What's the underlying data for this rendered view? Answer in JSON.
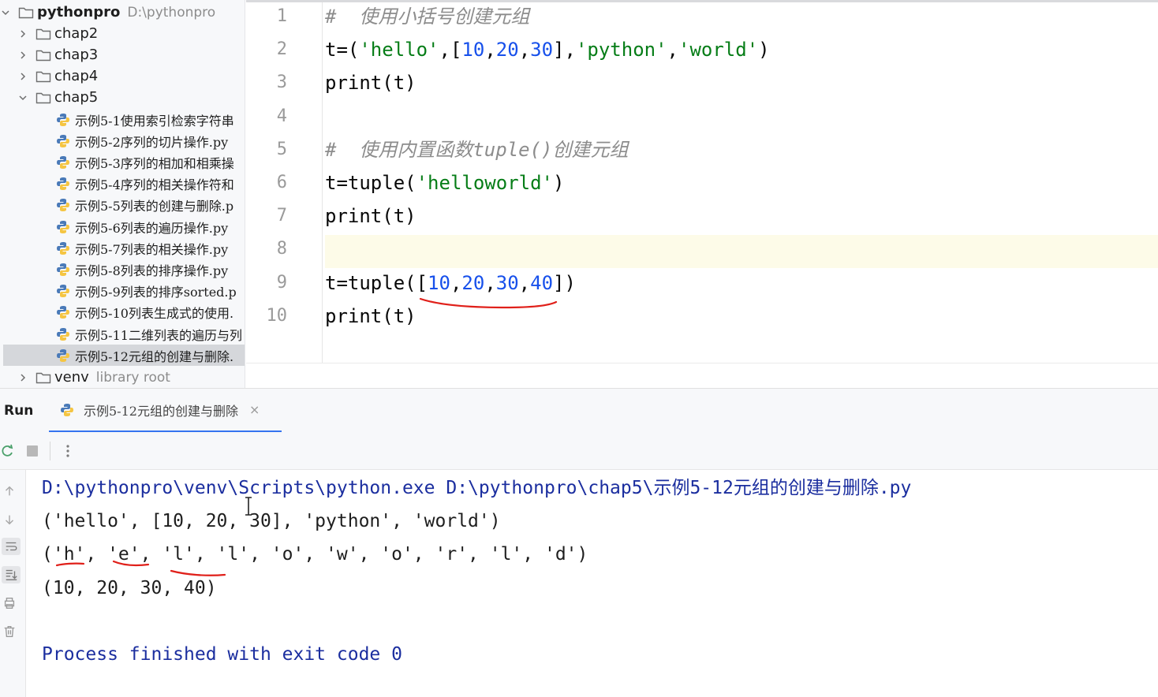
{
  "project": {
    "root": {
      "name": "pythonpro",
      "path": "D:\\pythonpro"
    },
    "folders": [
      "chap2",
      "chap3",
      "chap4"
    ],
    "open_folder": "chap5",
    "files": [
      "示例5-1使用索引检索字符串",
      "示例5-2序列的切片操作.py",
      "示例5-3序列的相加和相乘操",
      "示例5-4序列的相关操作符和",
      "示例5-5列表的创建与删除.p",
      "示例5-6列表的遍历操作.py",
      "示例5-7列表的相关操作.py",
      "示例5-8列表的排序操作.py",
      "示例5-9列表的排序sorted.p",
      "示例5-10列表生成式的使用.",
      "示例5-11二维列表的遍历与列",
      "示例5-12元组的创建与删除."
    ],
    "selected_file_index": 11,
    "venv": {
      "name": "venv",
      "hint": "library root"
    }
  },
  "editor": {
    "current_line": 8,
    "lines": [
      {
        "n": "1",
        "tokens": [
          [
            "cmt",
            "#  使用小括号创建元组"
          ]
        ]
      },
      {
        "n": "2",
        "tokens": [
          [
            "plain",
            "t=("
          ],
          [
            "str",
            "'hello'"
          ],
          [
            "plain",
            ",["
          ],
          [
            "num",
            "10"
          ],
          [
            "plain",
            ","
          ],
          [
            "num",
            "20"
          ],
          [
            "plain",
            ","
          ],
          [
            "num",
            "30"
          ],
          [
            "plain",
            "],"
          ],
          [
            "str",
            "'python'"
          ],
          [
            "plain",
            ","
          ],
          [
            "str",
            "'world'"
          ],
          [
            "plain",
            ")"
          ]
        ]
      },
      {
        "n": "3",
        "tokens": [
          [
            "plain",
            "print(t)"
          ]
        ]
      },
      {
        "n": "4",
        "tokens": []
      },
      {
        "n": "5",
        "tokens": [
          [
            "cmt",
            "#  使用内置函数tuple()创建元组"
          ]
        ]
      },
      {
        "n": "6",
        "tokens": [
          [
            "plain",
            "t=tuple("
          ],
          [
            "str",
            "'helloworld'"
          ],
          [
            "plain",
            ")"
          ]
        ]
      },
      {
        "n": "7",
        "tokens": [
          [
            "plain",
            "print(t)"
          ]
        ]
      },
      {
        "n": "8",
        "tokens": []
      },
      {
        "n": "9",
        "tokens": [
          [
            "plain",
            "t=tuple(["
          ],
          [
            "num",
            "10"
          ],
          [
            "plain",
            ","
          ],
          [
            "num",
            "20"
          ],
          [
            "plain",
            ","
          ],
          [
            "num",
            "30"
          ],
          [
            "plain",
            ","
          ],
          [
            "num",
            "40"
          ],
          [
            "plain",
            "])"
          ]
        ]
      },
      {
        "n": "10",
        "tokens": [
          [
            "plain",
            "print(t)"
          ]
        ]
      }
    ]
  },
  "run": {
    "title": "Run",
    "tab_label": "示例5-12元组的创建与删除",
    "tab_close": "×",
    "console": [
      {
        "type": "cmd",
        "text": "D:\\pythonpro\\venv\\Scripts\\python.exe D:\\pythonpro\\chap5\\示例5-12元组的创建与删除.py"
      },
      {
        "type": "out",
        "text": "('hello', [10, 20, 30], 'python', 'world')"
      },
      {
        "type": "out",
        "text": "('h', 'e', 'l', 'l', 'o', 'w', 'o', 'r', 'l', 'd')"
      },
      {
        "type": "out",
        "text": "(10, 20, 30, 40)"
      },
      {
        "type": "blank",
        "text": ""
      },
      {
        "type": "exit",
        "text": "Process finished with exit code 0"
      }
    ]
  },
  "colors": {
    "comment": "#8c8c8c",
    "string": "#067d17",
    "number": "#1750eb",
    "console_system": "#1b2e9f",
    "annotation_red": "#e0201a",
    "tab_underline": "#3574f0"
  }
}
